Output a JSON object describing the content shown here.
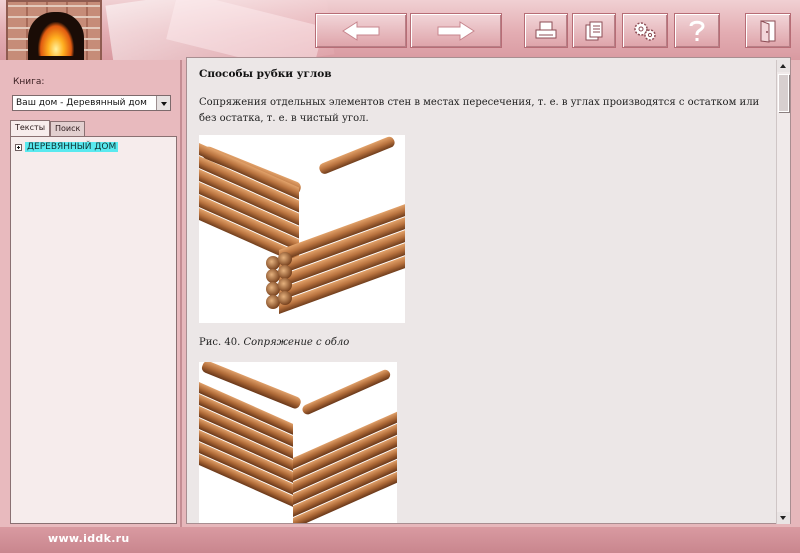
{
  "toolbar": {
    "buttons": [
      {
        "id": "back",
        "icon": "arrow-left-icon"
      },
      {
        "id": "forward",
        "icon": "arrow-right-icon"
      },
      {
        "id": "print",
        "icon": "printer-icon"
      },
      {
        "id": "copy",
        "icon": "documents-icon"
      },
      {
        "id": "settings",
        "icon": "gears-icon"
      },
      {
        "id": "help",
        "icon": "question-icon"
      },
      {
        "id": "exit",
        "icon": "exit-door-icon"
      }
    ]
  },
  "sidebar": {
    "book_label": "Книга:",
    "book_value": "Ваш дом - Деревянный дом",
    "tabs": [
      {
        "label": "Тексты",
        "active": true
      },
      {
        "label": "Поиск",
        "active": false
      }
    ],
    "tree": [
      {
        "label": "ДЕРЕВЯННЫЙ ДОМ",
        "highlight": "#59e9ef"
      }
    ]
  },
  "content": {
    "heading": "Способы рубки углов",
    "paragraph": "Сопряжения отдельных элементов стен в местах пересечения, т. е. в углах производятся с остатком или без остатка, т. е. в чистый угол.",
    "figure1_caption_prefix": "Рис. 40.",
    "figure1_caption_title": "Сопряжение с обло"
  },
  "footer": {
    "site": "www.iddk.ru"
  },
  "colors": {
    "panel": "#e8babe",
    "accent": "#59e9ef",
    "content_bg": "#ece7e7",
    "log": "#b9733f"
  }
}
